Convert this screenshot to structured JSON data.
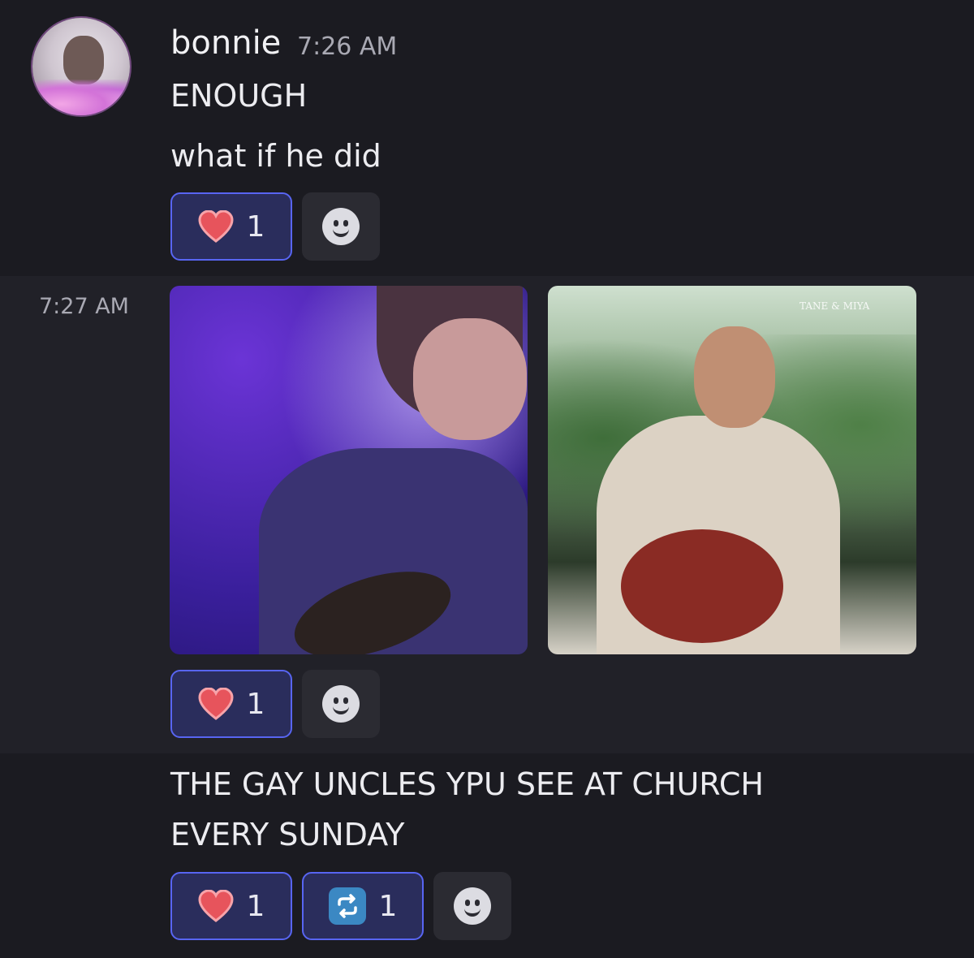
{
  "message": {
    "username": "bonnie",
    "time": "7:26 AM",
    "lines": [
      "ENOUGH",
      "what if he did"
    ],
    "reactions": [
      {
        "emoji": "heart",
        "count": "1"
      }
    ]
  },
  "attachment_group": {
    "time": "7:27 AM",
    "images": [
      {
        "description_icon": "photo"
      },
      {
        "description_icon": "photo",
        "overlay_text": "TANE & MIYA"
      }
    ],
    "reactions": [
      {
        "emoji": "heart",
        "count": "1"
      }
    ]
  },
  "third_message": {
    "lines": [
      "THE GAY UNCLES YPU SEE AT CHURCH",
      "EVERY SUNDAY"
    ],
    "reactions": [
      {
        "emoji": "heart",
        "count": "1"
      },
      {
        "emoji": "repeat",
        "count": "1"
      }
    ]
  },
  "colors": {
    "background": "#1b1b21",
    "highlight": "#212128",
    "reaction_active_bg": "#2a2d5c",
    "reaction_active_border": "#5865f2",
    "heart": "#e7545c"
  }
}
